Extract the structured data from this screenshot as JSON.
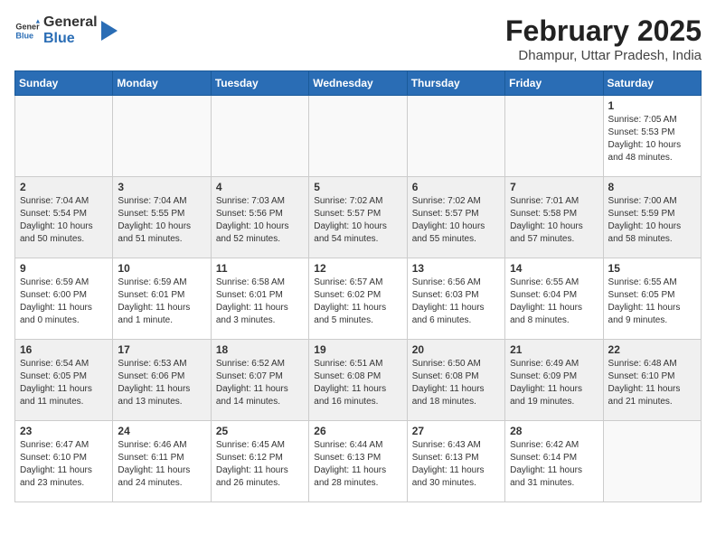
{
  "header": {
    "logo_general": "General",
    "logo_blue": "Blue",
    "month_year": "February 2025",
    "location": "Dhampur, Uttar Pradesh, India"
  },
  "weekdays": [
    "Sunday",
    "Monday",
    "Tuesday",
    "Wednesday",
    "Thursday",
    "Friday",
    "Saturday"
  ],
  "weeks": [
    [
      {
        "day": "",
        "info": ""
      },
      {
        "day": "",
        "info": ""
      },
      {
        "day": "",
        "info": ""
      },
      {
        "day": "",
        "info": ""
      },
      {
        "day": "",
        "info": ""
      },
      {
        "day": "",
        "info": ""
      },
      {
        "day": "1",
        "info": "Sunrise: 7:05 AM\nSunset: 5:53 PM\nDaylight: 10 hours and 48 minutes."
      }
    ],
    [
      {
        "day": "2",
        "info": "Sunrise: 7:04 AM\nSunset: 5:54 PM\nDaylight: 10 hours and 50 minutes."
      },
      {
        "day": "3",
        "info": "Sunrise: 7:04 AM\nSunset: 5:55 PM\nDaylight: 10 hours and 51 minutes."
      },
      {
        "day": "4",
        "info": "Sunrise: 7:03 AM\nSunset: 5:56 PM\nDaylight: 10 hours and 52 minutes."
      },
      {
        "day": "5",
        "info": "Sunrise: 7:02 AM\nSunset: 5:57 PM\nDaylight: 10 hours and 54 minutes."
      },
      {
        "day": "6",
        "info": "Sunrise: 7:02 AM\nSunset: 5:57 PM\nDaylight: 10 hours and 55 minutes."
      },
      {
        "day": "7",
        "info": "Sunrise: 7:01 AM\nSunset: 5:58 PM\nDaylight: 10 hours and 57 minutes."
      },
      {
        "day": "8",
        "info": "Sunrise: 7:00 AM\nSunset: 5:59 PM\nDaylight: 10 hours and 58 minutes."
      }
    ],
    [
      {
        "day": "9",
        "info": "Sunrise: 6:59 AM\nSunset: 6:00 PM\nDaylight: 11 hours and 0 minutes."
      },
      {
        "day": "10",
        "info": "Sunrise: 6:59 AM\nSunset: 6:01 PM\nDaylight: 11 hours and 1 minute."
      },
      {
        "day": "11",
        "info": "Sunrise: 6:58 AM\nSunset: 6:01 PM\nDaylight: 11 hours and 3 minutes."
      },
      {
        "day": "12",
        "info": "Sunrise: 6:57 AM\nSunset: 6:02 PM\nDaylight: 11 hours and 5 minutes."
      },
      {
        "day": "13",
        "info": "Sunrise: 6:56 AM\nSunset: 6:03 PM\nDaylight: 11 hours and 6 minutes."
      },
      {
        "day": "14",
        "info": "Sunrise: 6:55 AM\nSunset: 6:04 PM\nDaylight: 11 hours and 8 minutes."
      },
      {
        "day": "15",
        "info": "Sunrise: 6:55 AM\nSunset: 6:05 PM\nDaylight: 11 hours and 9 minutes."
      }
    ],
    [
      {
        "day": "16",
        "info": "Sunrise: 6:54 AM\nSunset: 6:05 PM\nDaylight: 11 hours and 11 minutes."
      },
      {
        "day": "17",
        "info": "Sunrise: 6:53 AM\nSunset: 6:06 PM\nDaylight: 11 hours and 13 minutes."
      },
      {
        "day": "18",
        "info": "Sunrise: 6:52 AM\nSunset: 6:07 PM\nDaylight: 11 hours and 14 minutes."
      },
      {
        "day": "19",
        "info": "Sunrise: 6:51 AM\nSunset: 6:08 PM\nDaylight: 11 hours and 16 minutes."
      },
      {
        "day": "20",
        "info": "Sunrise: 6:50 AM\nSunset: 6:08 PM\nDaylight: 11 hours and 18 minutes."
      },
      {
        "day": "21",
        "info": "Sunrise: 6:49 AM\nSunset: 6:09 PM\nDaylight: 11 hours and 19 minutes."
      },
      {
        "day": "22",
        "info": "Sunrise: 6:48 AM\nSunset: 6:10 PM\nDaylight: 11 hours and 21 minutes."
      }
    ],
    [
      {
        "day": "23",
        "info": "Sunrise: 6:47 AM\nSunset: 6:10 PM\nDaylight: 11 hours and 23 minutes."
      },
      {
        "day": "24",
        "info": "Sunrise: 6:46 AM\nSunset: 6:11 PM\nDaylight: 11 hours and 24 minutes."
      },
      {
        "day": "25",
        "info": "Sunrise: 6:45 AM\nSunset: 6:12 PM\nDaylight: 11 hours and 26 minutes."
      },
      {
        "day": "26",
        "info": "Sunrise: 6:44 AM\nSunset: 6:13 PM\nDaylight: 11 hours and 28 minutes."
      },
      {
        "day": "27",
        "info": "Sunrise: 6:43 AM\nSunset: 6:13 PM\nDaylight: 11 hours and 30 minutes."
      },
      {
        "day": "28",
        "info": "Sunrise: 6:42 AM\nSunset: 6:14 PM\nDaylight: 11 hours and 31 minutes."
      },
      {
        "day": "",
        "info": ""
      }
    ]
  ]
}
